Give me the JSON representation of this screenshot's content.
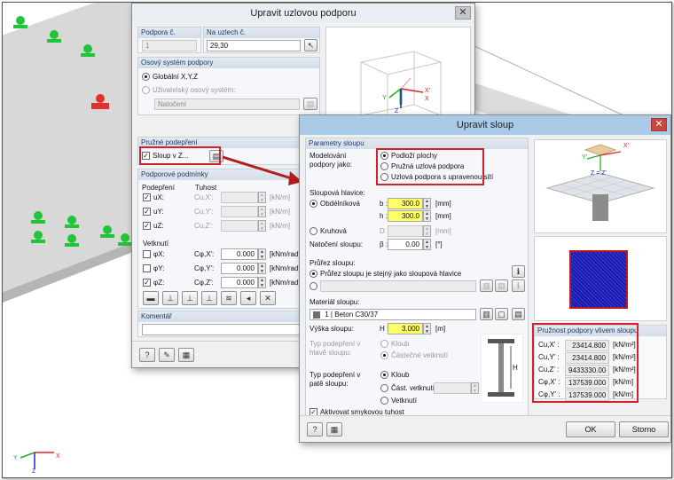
{
  "dialog1": {
    "title": "Upravit uzlovou podporu",
    "support_no_label": "Podpora č.",
    "support_no_value": "1",
    "at_nodes_label": "Na uzlech č.",
    "at_nodes_value": "29,30",
    "axis_group_title": "Osový systém podpory",
    "axis_global": "Globální X,Y,Z",
    "axis_user": "Uživatelský osový systém:",
    "axis_rotation_value": "Natočení",
    "elastic_group_title": "Pružné podepření",
    "elastic_column_label": "Sloup v Z...",
    "conditions_group_title": "Podporové podmínky",
    "col_support": "Podepření",
    "col_stiffness": "Tuhost",
    "supports": [
      {
        "label": "uX:",
        "stiff_label": "Cu,X':",
        "unit": "[kN/m]"
      },
      {
        "label": "uY:",
        "stiff_label": "Cu,Y':",
        "unit": "[kN/m]"
      },
      {
        "label": "uZ:",
        "stiff_label": "Cu,Z':",
        "unit": "[kN/m]"
      }
    ],
    "fixity_title": "Vetknutí",
    "fixities": [
      {
        "label": "φX:",
        "stiff_label": "Cφ,X':",
        "value": "0.000",
        "unit": "[kNm/rad]"
      },
      {
        "label": "φY:",
        "stiff_label": "Cφ,Y':",
        "value": "0.000",
        "unit": "[kNm/rad]"
      },
      {
        "label": "φZ:",
        "stiff_label": "Cφ,Z':",
        "value": "0.000",
        "unit": "[kNm/rad]"
      }
    ],
    "comment_group_title": "Komentář",
    "preview_axes": {
      "x": "X",
      "y": "Y",
      "z": "Z",
      "xp": "X'",
      "yp": "Y'",
      "zp": "Z'"
    }
  },
  "dialog2": {
    "title": "Upravit sloup",
    "params_group_title": "Parametry sloupu",
    "modeling_label": "Modelování podpory jako:",
    "modeling_options": [
      "Podloží plochy",
      "Pružná uzlová podpora",
      "Uzlová podpora s upravenou sítí"
    ],
    "head_label": "Sloupová hlavice:",
    "rect_label": "Obdélníková",
    "b_label": "b :",
    "b_value": "300.0",
    "h_label": "h :",
    "h_value": "300.0",
    "unit_mm": "[mm]",
    "circ_label": "Kruhová",
    "d_label": "D :",
    "rotation_label": "Natočení sloupu:",
    "beta_label": "β :",
    "beta_value": "0.00",
    "unit_deg": "[°]",
    "section_label": "Průřez sloupu:",
    "section_same": "Průřez sloupu je stejný jako sloupová hlavice",
    "material_label": "Materiál sloupu:",
    "material_no": "1",
    "material_value": "Beton C30/37",
    "height_label": "Výška sloupu:",
    "height_h_label": "H :",
    "height_value": "3.000",
    "unit_m": "[m]",
    "top_type_label": "Typ podepření v hlavě sloupu:",
    "top_hinge": "Kloub",
    "top_partial": "Částečné vetknutí",
    "foot_type_label": "Typ podepření v patě sloupu:",
    "foot_hinge": "Kloub",
    "foot_partial": "Část. vetknutí",
    "foot_fixed": "Vetknutí",
    "unit_pct": "[%]",
    "shear_label": "Aktivovat smykovou tuhost",
    "ok_label": "OK",
    "cancel_label": "Storno",
    "stiffness_title": "Pružnost podpory vlivem sloupu",
    "stiffness_rows": [
      {
        "label": "Cu,X' :",
        "value": "23414.800",
        "unit": "[kN/m²]"
      },
      {
        "label": "Cu,Y' :",
        "value": "23414.800",
        "unit": "[kN/m²]"
      },
      {
        "label": "Cu,Z' :",
        "value": "9433330.00",
        "unit": "[kN/m²]"
      },
      {
        "label": "Cφ,X' :",
        "value": "137539.000",
        "unit": "[kN/m]"
      },
      {
        "label": "Cφ,Y' :",
        "value": "137539.000",
        "unit": "[kN/m]"
      }
    ],
    "preview_axes": {
      "x": "X",
      "y": "Y",
      "zz": "Z = Z'",
      "xp": "X'",
      "yp": "Y'"
    },
    "dim_label": "H"
  },
  "axis_tripod": {
    "x": "X",
    "y": "Y",
    "z": "Z"
  },
  "colors": {
    "highlight_red": "#d4202a",
    "support_green": "#22c43a",
    "input_yellow": "#ffff66",
    "title_blue": "#aacbe8"
  }
}
